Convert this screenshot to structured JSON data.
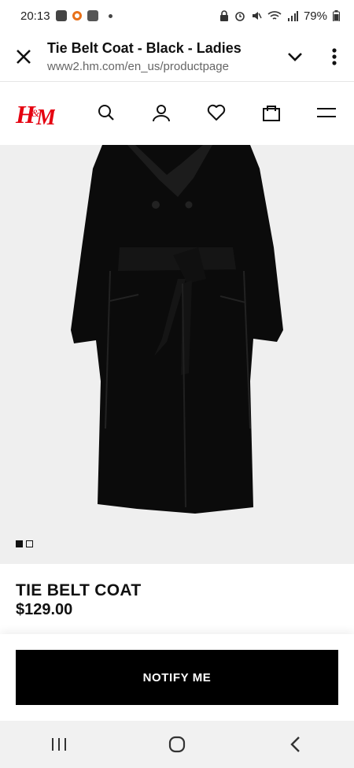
{
  "status_bar": {
    "time": "20:13",
    "battery": "79%",
    "left_icons": [
      "notification-app-icon",
      "orange-ring-icon",
      "screen-record-icon",
      "dot-icon"
    ],
    "right_icons": [
      "lock-icon",
      "alarm-icon",
      "mute-icon",
      "wifi-icon",
      "signal-icon",
      "battery-icon"
    ]
  },
  "browser": {
    "title": "Tie Belt Coat - Black - Ladies",
    "url": "www2.hm.com/en_us/productpage"
  },
  "site": {
    "logo_text": "H&M",
    "brand_color": "#e50010",
    "header_icons": [
      "search-icon",
      "account-icon",
      "favorites-icon",
      "bag-icon",
      "menu-icon"
    ]
  },
  "gallery": {
    "image_count": 2,
    "active_index": 0
  },
  "product": {
    "name": "TIE BELT COAT",
    "price": "$129.00"
  },
  "actions": {
    "notify_label": "NOTIFY ME"
  },
  "system_nav": [
    "recents-icon",
    "home-icon",
    "back-icon"
  ]
}
